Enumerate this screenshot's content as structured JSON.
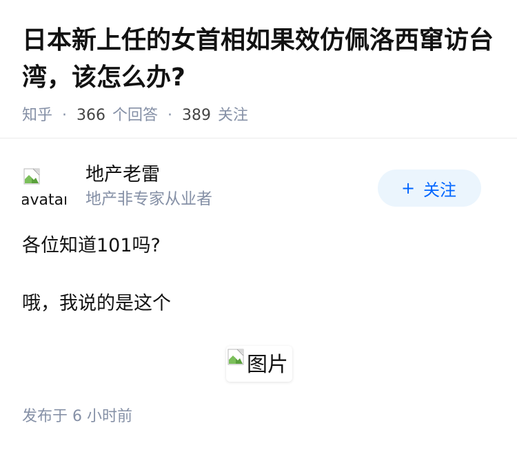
{
  "question": {
    "title": "日本新上任的女首相如果效仿佩洛西窜访台湾，该怎么办?",
    "source": "知乎",
    "separator": "·",
    "answer_count": "366",
    "answer_label": "个回答",
    "follower_count": "389",
    "follower_label": "关注"
  },
  "answer": {
    "author": {
      "avatar_alt": "avatar",
      "name": "地产老雷",
      "bio": "地产非专家从业者"
    },
    "follow_button": {
      "icon": "plus-icon",
      "icon_glyph": "+",
      "label": "关注",
      "color": "#0066ff",
      "background": "#ebf5fd"
    },
    "paragraphs": [
      "各位知道101吗?",
      "哦，我说的是这个"
    ],
    "image_alt": "图片",
    "publish_time": "发布于 6 小时前"
  },
  "colors": {
    "title": "#121212",
    "meta": "#8590a6",
    "divider": "#ebebeb"
  }
}
